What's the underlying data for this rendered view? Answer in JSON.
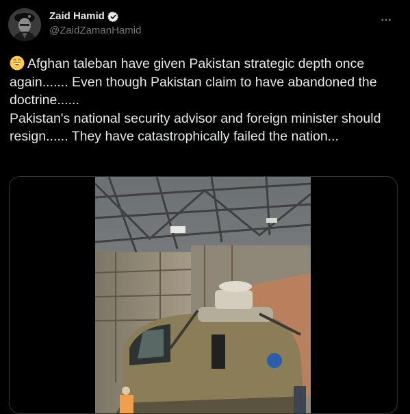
{
  "author": {
    "display_name": "Zaid Hamid",
    "handle": "@ZaidZamanHamid",
    "verified_icon": "verified-badge-icon",
    "avatar_icon": "avatar-beret-portrait"
  },
  "more_icon": "more-horizontal-icon",
  "tweet": {
    "emoji": "grinning-face-emoji",
    "text": "Afghan taleban have given Pakistan strategic depth once again....... Even though Pakistan claim to have abandoned the doctrine......\nPakistan's national security advisor and foreign minister should resign...... They have catastrophically failed the nation..."
  },
  "media": {
    "type": "video",
    "icon": "video-thumbnail-helicopter-hangar"
  },
  "colors": {
    "background": "#000000",
    "text_primary": "#e7e9ea",
    "text_secondary": "#71767b",
    "border": "#2f3336",
    "verified": "#e7e9ea"
  }
}
